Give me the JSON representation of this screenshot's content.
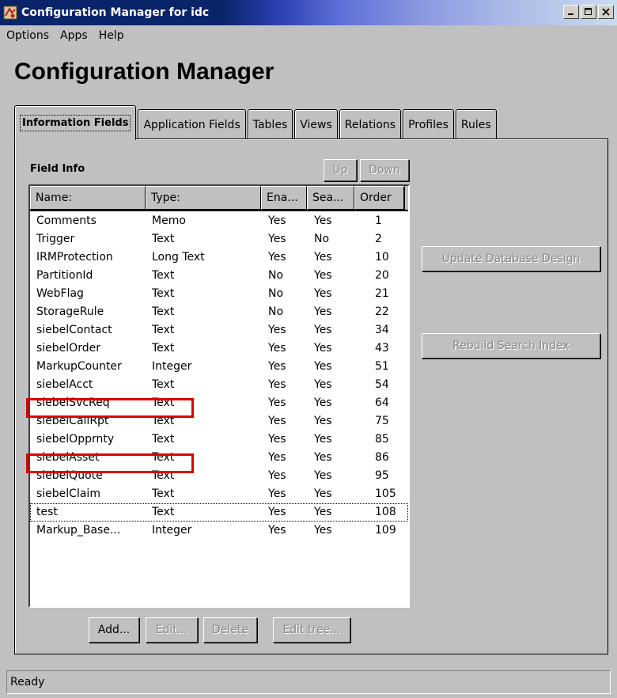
{
  "window": {
    "title": "Configuration Manager for idc",
    "icon": "app-icon",
    "controls": [
      "minimize-icon",
      "maximize-icon",
      "close-icon"
    ]
  },
  "menu": {
    "items": [
      "Options",
      "Apps",
      "Help"
    ]
  },
  "header": {
    "title": "Configuration Manager"
  },
  "tabs": [
    {
      "label": "Information Fields",
      "active": true
    },
    {
      "label": "Application Fields"
    },
    {
      "label": "Tables"
    },
    {
      "label": "Views"
    },
    {
      "label": "Relations"
    },
    {
      "label": "Profiles"
    },
    {
      "label": "Rules"
    }
  ],
  "field_info": {
    "label": "Field Info",
    "up_label": "Up",
    "down_label": "Down",
    "columns": [
      "Name:",
      "Type:",
      "Ena...",
      "Sea...",
      "Order"
    ],
    "rows": [
      [
        "Comments",
        "Memo",
        "Yes",
        "Yes",
        "1"
      ],
      [
        "Trigger",
        "Text",
        "Yes",
        "No",
        "2"
      ],
      [
        "IRMProtection",
        "Long Text",
        "Yes",
        "Yes",
        "10"
      ],
      [
        "PartitionId",
        "Text",
        "No",
        "Yes",
        "20"
      ],
      [
        "WebFlag",
        "Text",
        "No",
        "Yes",
        "21"
      ],
      [
        "StorageRule",
        "Text",
        "No",
        "Yes",
        "22"
      ],
      [
        "siebelContact",
        "Text",
        "Yes",
        "Yes",
        "34"
      ],
      [
        "siebelOrder",
        "Text",
        "Yes",
        "Yes",
        "43"
      ],
      [
        "MarkupCounter",
        "Integer",
        "Yes",
        "Yes",
        "51"
      ],
      [
        "siebelAcct",
        "Text",
        "Yes",
        "Yes",
        "54"
      ],
      [
        "siebelSvcReq",
        "Text",
        "Yes",
        "Yes",
        "64"
      ],
      [
        "siebelCallRpt",
        "Text",
        "Yes",
        "Yes",
        "75"
      ],
      [
        "siebelOpprnty",
        "Text",
        "Yes",
        "Yes",
        "85"
      ],
      [
        "siebelAsset",
        "Text",
        "Yes",
        "Yes",
        "86"
      ],
      [
        "siebelQuote",
        "Text",
        "Yes",
        "Yes",
        "95"
      ],
      [
        "siebelClaim",
        "Text",
        "Yes",
        "Yes",
        "105"
      ],
      [
        "test",
        "Text",
        "Yes",
        "Yes",
        "108"
      ],
      [
        "Markup_Base...",
        "Integer",
        "Yes",
        "Yes",
        "109"
      ]
    ],
    "selected_row": "test",
    "highlighted_rows": [
      "siebelSvcReq",
      "siebelAsset"
    ],
    "highlight_color": "#e00000"
  },
  "actions": {
    "add": "Add...",
    "edit": "Edit...",
    "delete": "Delete",
    "edit_tree": "Edit tree...",
    "update_db": "Update Database Design",
    "rebuild_index": "Rebuild Search Index"
  },
  "status": {
    "text": "Ready"
  }
}
